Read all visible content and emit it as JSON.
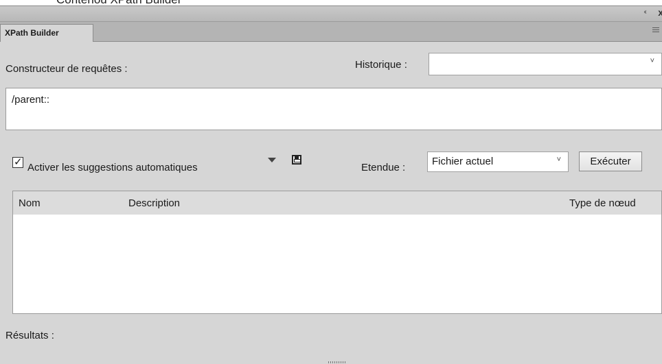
{
  "window": {
    "above_title": "Contenou XPath Builder",
    "tab_label": "XPath Builder",
    "collapse_glyph": "‹‹",
    "close_glyph": "x"
  },
  "query_builder": {
    "label": "Constructeur de requêtes :",
    "value": "/parent::"
  },
  "history": {
    "label": "Historique :",
    "selected": ""
  },
  "options": {
    "autosuggest_label": "Activer les suggestions automatiques",
    "autosuggest_checked": true
  },
  "scope": {
    "label": "Etendue :",
    "selected": "Fichier actuel"
  },
  "execute_button": {
    "label": "Exécuter"
  },
  "table": {
    "columns": [
      "Nom",
      "Description",
      "Type de nœud"
    ],
    "rows": []
  },
  "results": {
    "label": "Résultats :"
  },
  "colors": {
    "panel_bg": "#d6d6d6",
    "tab_strip_bg": "#b4b4b4"
  }
}
